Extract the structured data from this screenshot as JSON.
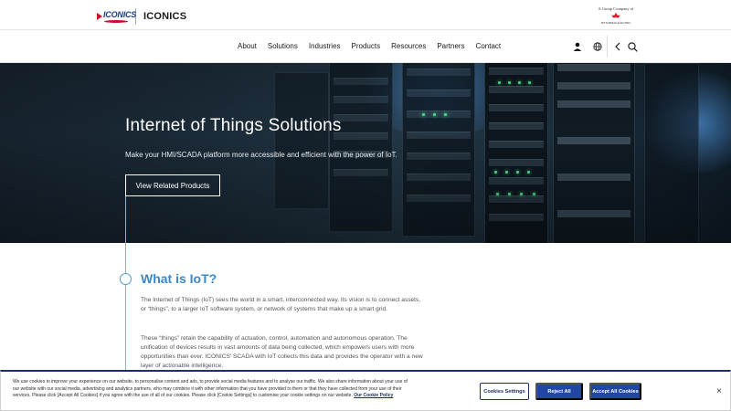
{
  "brand": {
    "logo_word": "ICONICS",
    "name": "ICONICS",
    "group_line": "A Group Company of",
    "parent_label": "MITSUBISHI ELECTRIC"
  },
  "nav": {
    "items": [
      "About",
      "Solutions",
      "Industries",
      "Products",
      "Resources",
      "Partners",
      "Contact"
    ],
    "icons": [
      "user-icon",
      "globe-icon",
      "chevron-left-icon",
      "search-icon"
    ]
  },
  "hero": {
    "title": "Internet of Things Solutions",
    "subtitle": "Make your HMI/SCADA platform more accessible and efficient with the power of IoT.",
    "button": "View Related Products"
  },
  "section": {
    "title": "What is IoT?",
    "paragraph1": "The Internet of Things (IoT) sees the world in a smart, interconnected way. Its vision is to connect assets, or “things”, to a larger IoT software system, or network of systems that make up a smart grid.",
    "paragraph2": "These “things” retain the capability of actuation, control, automation and autonomous operation. The unification of devices results in vast amounts of data being collected, which empowers users with more opportunities than ever. ICONICS' SCADA with IoT collects this data and provides the operator with a new layer of actionable intelligence."
  },
  "cookie": {
    "text": "We use cookies to improve your experience on our website, to personalise content and ads, to provide social media features and to analyse our traffic. We also share information about your use of our website with our social media, advertising and analytics partners, who may combine it with other information that you have provided to them or that they have collected from your use of their services. Please click [Accept All Cookies] if you agree with the use of all of our cookies. Please click [Cookie Settings] to customise your cookie settings on our website.",
    "policy_link": "Our Cookie Policy",
    "settings_button": "Cookies Settings",
    "reject_button": "Reject All",
    "accept_button": "Accept All Cookies",
    "close": "×"
  },
  "colors": {
    "accent": "#3b88c8",
    "cookie_primary": "#2147a4",
    "cookie_border": "#1e2f67"
  }
}
